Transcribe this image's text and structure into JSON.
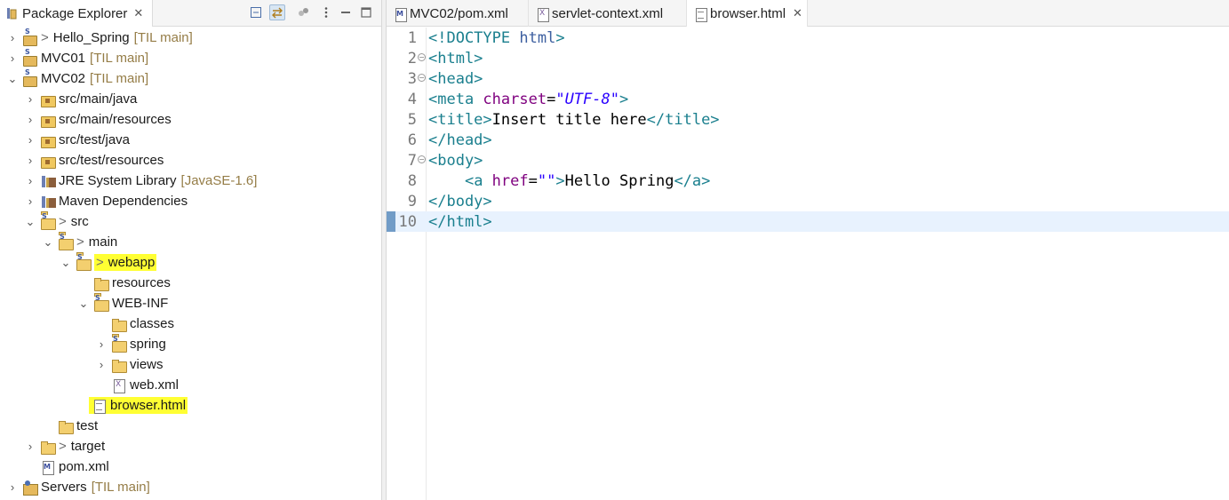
{
  "package_explorer": {
    "title": "Package Explorer",
    "close": "✕"
  },
  "tree": {
    "hello_spring": {
      "name": "Hello_Spring",
      "badge": "[TIL main]"
    },
    "mvc01": {
      "name": "MVC01",
      "badge": "[TIL main]"
    },
    "mvc02": {
      "name": "MVC02",
      "badge": "[TIL main]"
    },
    "src_main_java": "src/main/java",
    "src_main_resources": "src/main/resources",
    "src_test_java": "src/test/java",
    "src_test_resources": "src/test/resources",
    "jre": {
      "name": "JRE System Library",
      "badge": "[JavaSE-1.6]"
    },
    "maven_deps": "Maven Dependencies",
    "src": "src",
    "main": "main",
    "webapp": "webapp",
    "resources": "resources",
    "web_inf": "WEB-INF",
    "classes": "classes",
    "spring": "spring",
    "views": "views",
    "web_xml": "web.xml",
    "browser_html": "browser.html",
    "test": "test",
    "target": "target",
    "pom_xml": "pom.xml",
    "servers": {
      "name": "Servers",
      "badge": "[TIL main]"
    }
  },
  "editor_tabs": [
    {
      "label": "MVC02/pom.xml"
    },
    {
      "label": "servlet-context.xml"
    },
    {
      "label": "browser.html",
      "close": "✕"
    }
  ],
  "code": {
    "lines": [
      "1",
      "2",
      "3",
      "4",
      "5",
      "6",
      "7",
      "8",
      "9",
      "10"
    ],
    "l1": {
      "p1": "<!DOCTYPE ",
      "p2": "html",
      "p3": ">"
    },
    "l2": "<html>",
    "l3": "<head>",
    "l4": {
      "p1": "<meta ",
      "p2": "charset",
      "p3": "=",
      "p4": "\"UTF-8\"",
      "p5": ">"
    },
    "l5": {
      "p1": "<title>",
      "p2": "Insert title here",
      "p3": "</title>"
    },
    "l6": "</head>",
    "l7": "<body>",
    "l8": {
      "indent": "    ",
      "p1": "<a ",
      "p2": "href",
      "p3": "=",
      "p4": "\"\"",
      "p5": ">",
      "p6": "Hello Spring",
      "p7": "</a>"
    },
    "l9": "</body>",
    "l10": "</html>"
  },
  "colors": {
    "highlight": "#ffff33",
    "tag": "#1a7f8e",
    "attribute": "#7f007f",
    "string": "#2a00ff",
    "current_line": "#e8f2fe"
  }
}
